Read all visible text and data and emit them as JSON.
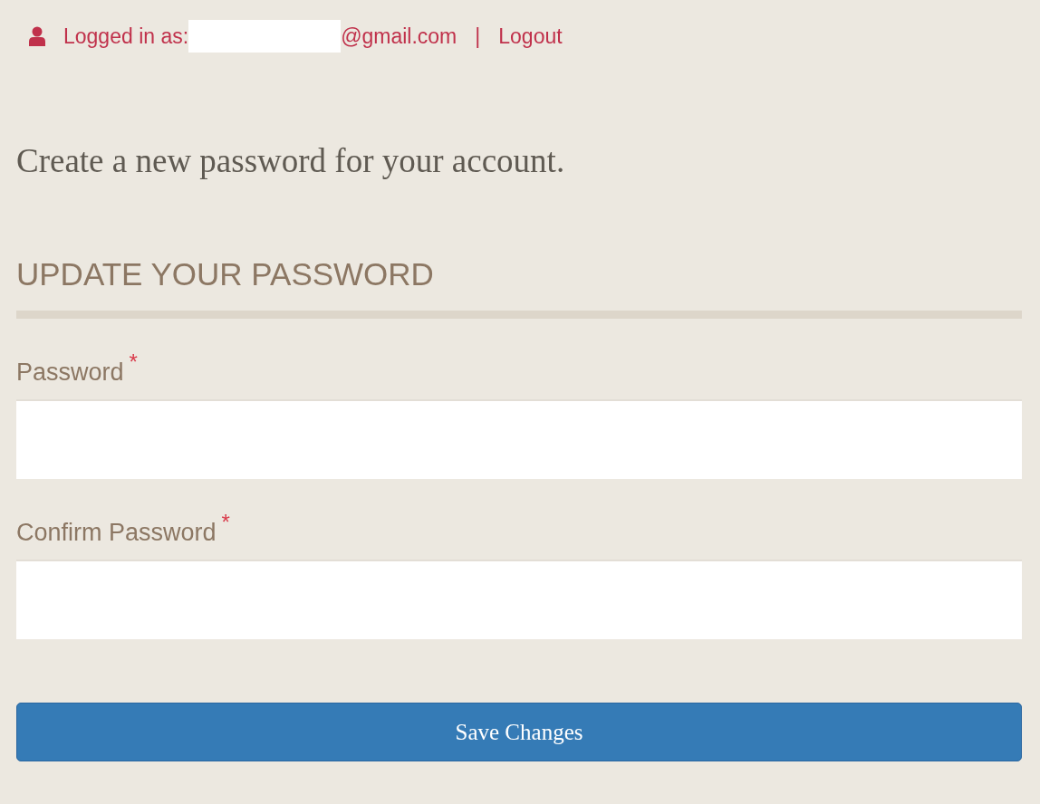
{
  "account_bar": {
    "label": "Logged in as:",
    "email_redacted": true,
    "email": "@gmail.com",
    "separator": "|",
    "logout": "Logout"
  },
  "intro": "Create a new password for your account.",
  "section_title": "UPDATE YOUR PASSWORD",
  "fields": [
    {
      "label": "Password",
      "required_mark": "*"
    },
    {
      "label": "Confirm Password",
      "required_mark": "*"
    }
  ],
  "submit": "Save Changes"
}
